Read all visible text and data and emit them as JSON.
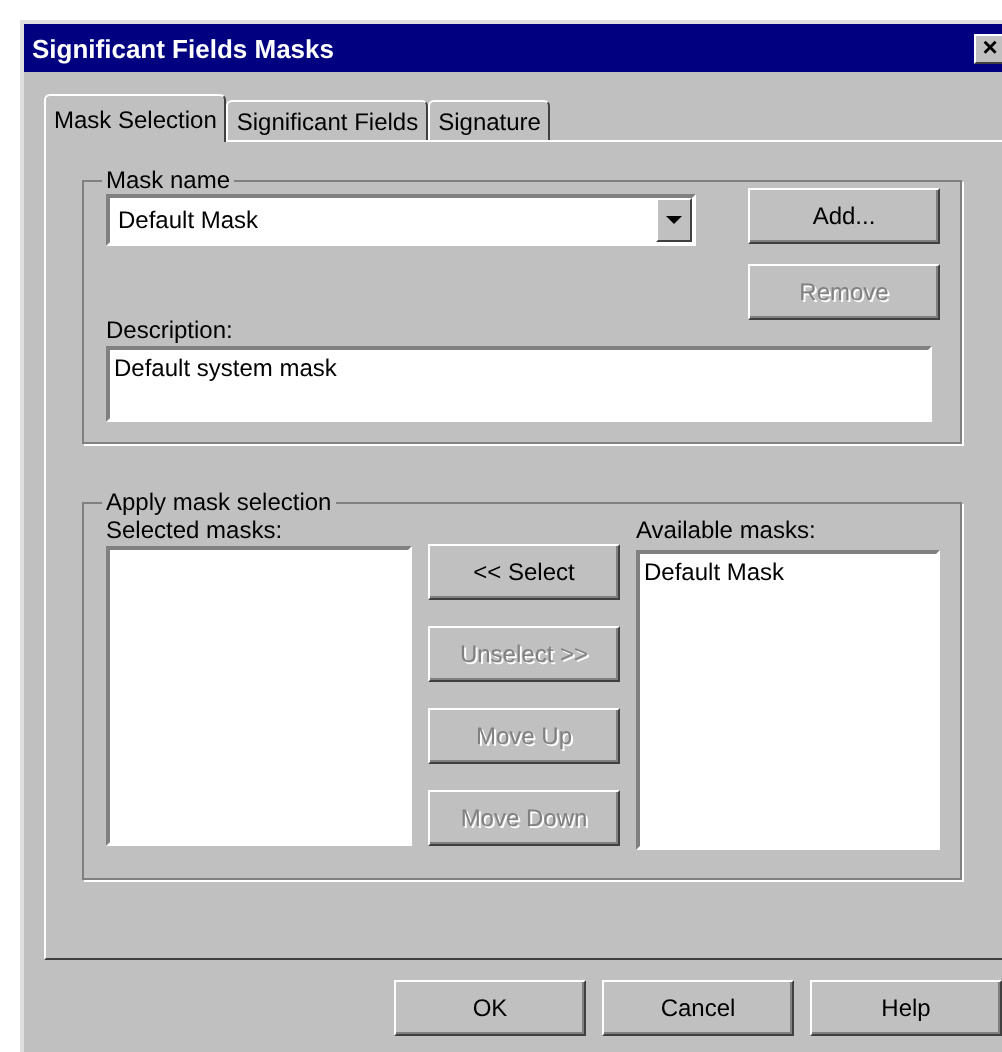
{
  "window": {
    "title": "Significant Fields Masks",
    "close": "×"
  },
  "tabs": [
    {
      "label": "Mask Selection",
      "selected": true
    },
    {
      "label": "Significant Fields",
      "selected": false
    },
    {
      "label": "Signature",
      "selected": false
    }
  ],
  "mask_name": {
    "legend": "Mask name",
    "value": "Default Mask",
    "buttons": [
      {
        "label": "Add...",
        "disabled": false
      },
      {
        "label": "Remove",
        "disabled": true
      }
    ],
    "description_label": "Description:",
    "description": "Default system mask"
  },
  "apply": {
    "legend": "Apply mask selection",
    "selected_label": "Selected masks:",
    "buttons": [
      {
        "label": "<< Select",
        "disabled": false
      },
      {
        "label": "Unselect >>",
        "disabled": true
      },
      {
        "label": "Move Up",
        "disabled": true
      },
      {
        "label": "Move Down",
        "disabled": true
      }
    ],
    "available_label": "Available masks:",
    "available_items": [
      "Default Mask"
    ]
  },
  "buttons": [
    {
      "label": "OK"
    },
    {
      "label": "Cancel"
    },
    {
      "label": "Help"
    }
  ]
}
